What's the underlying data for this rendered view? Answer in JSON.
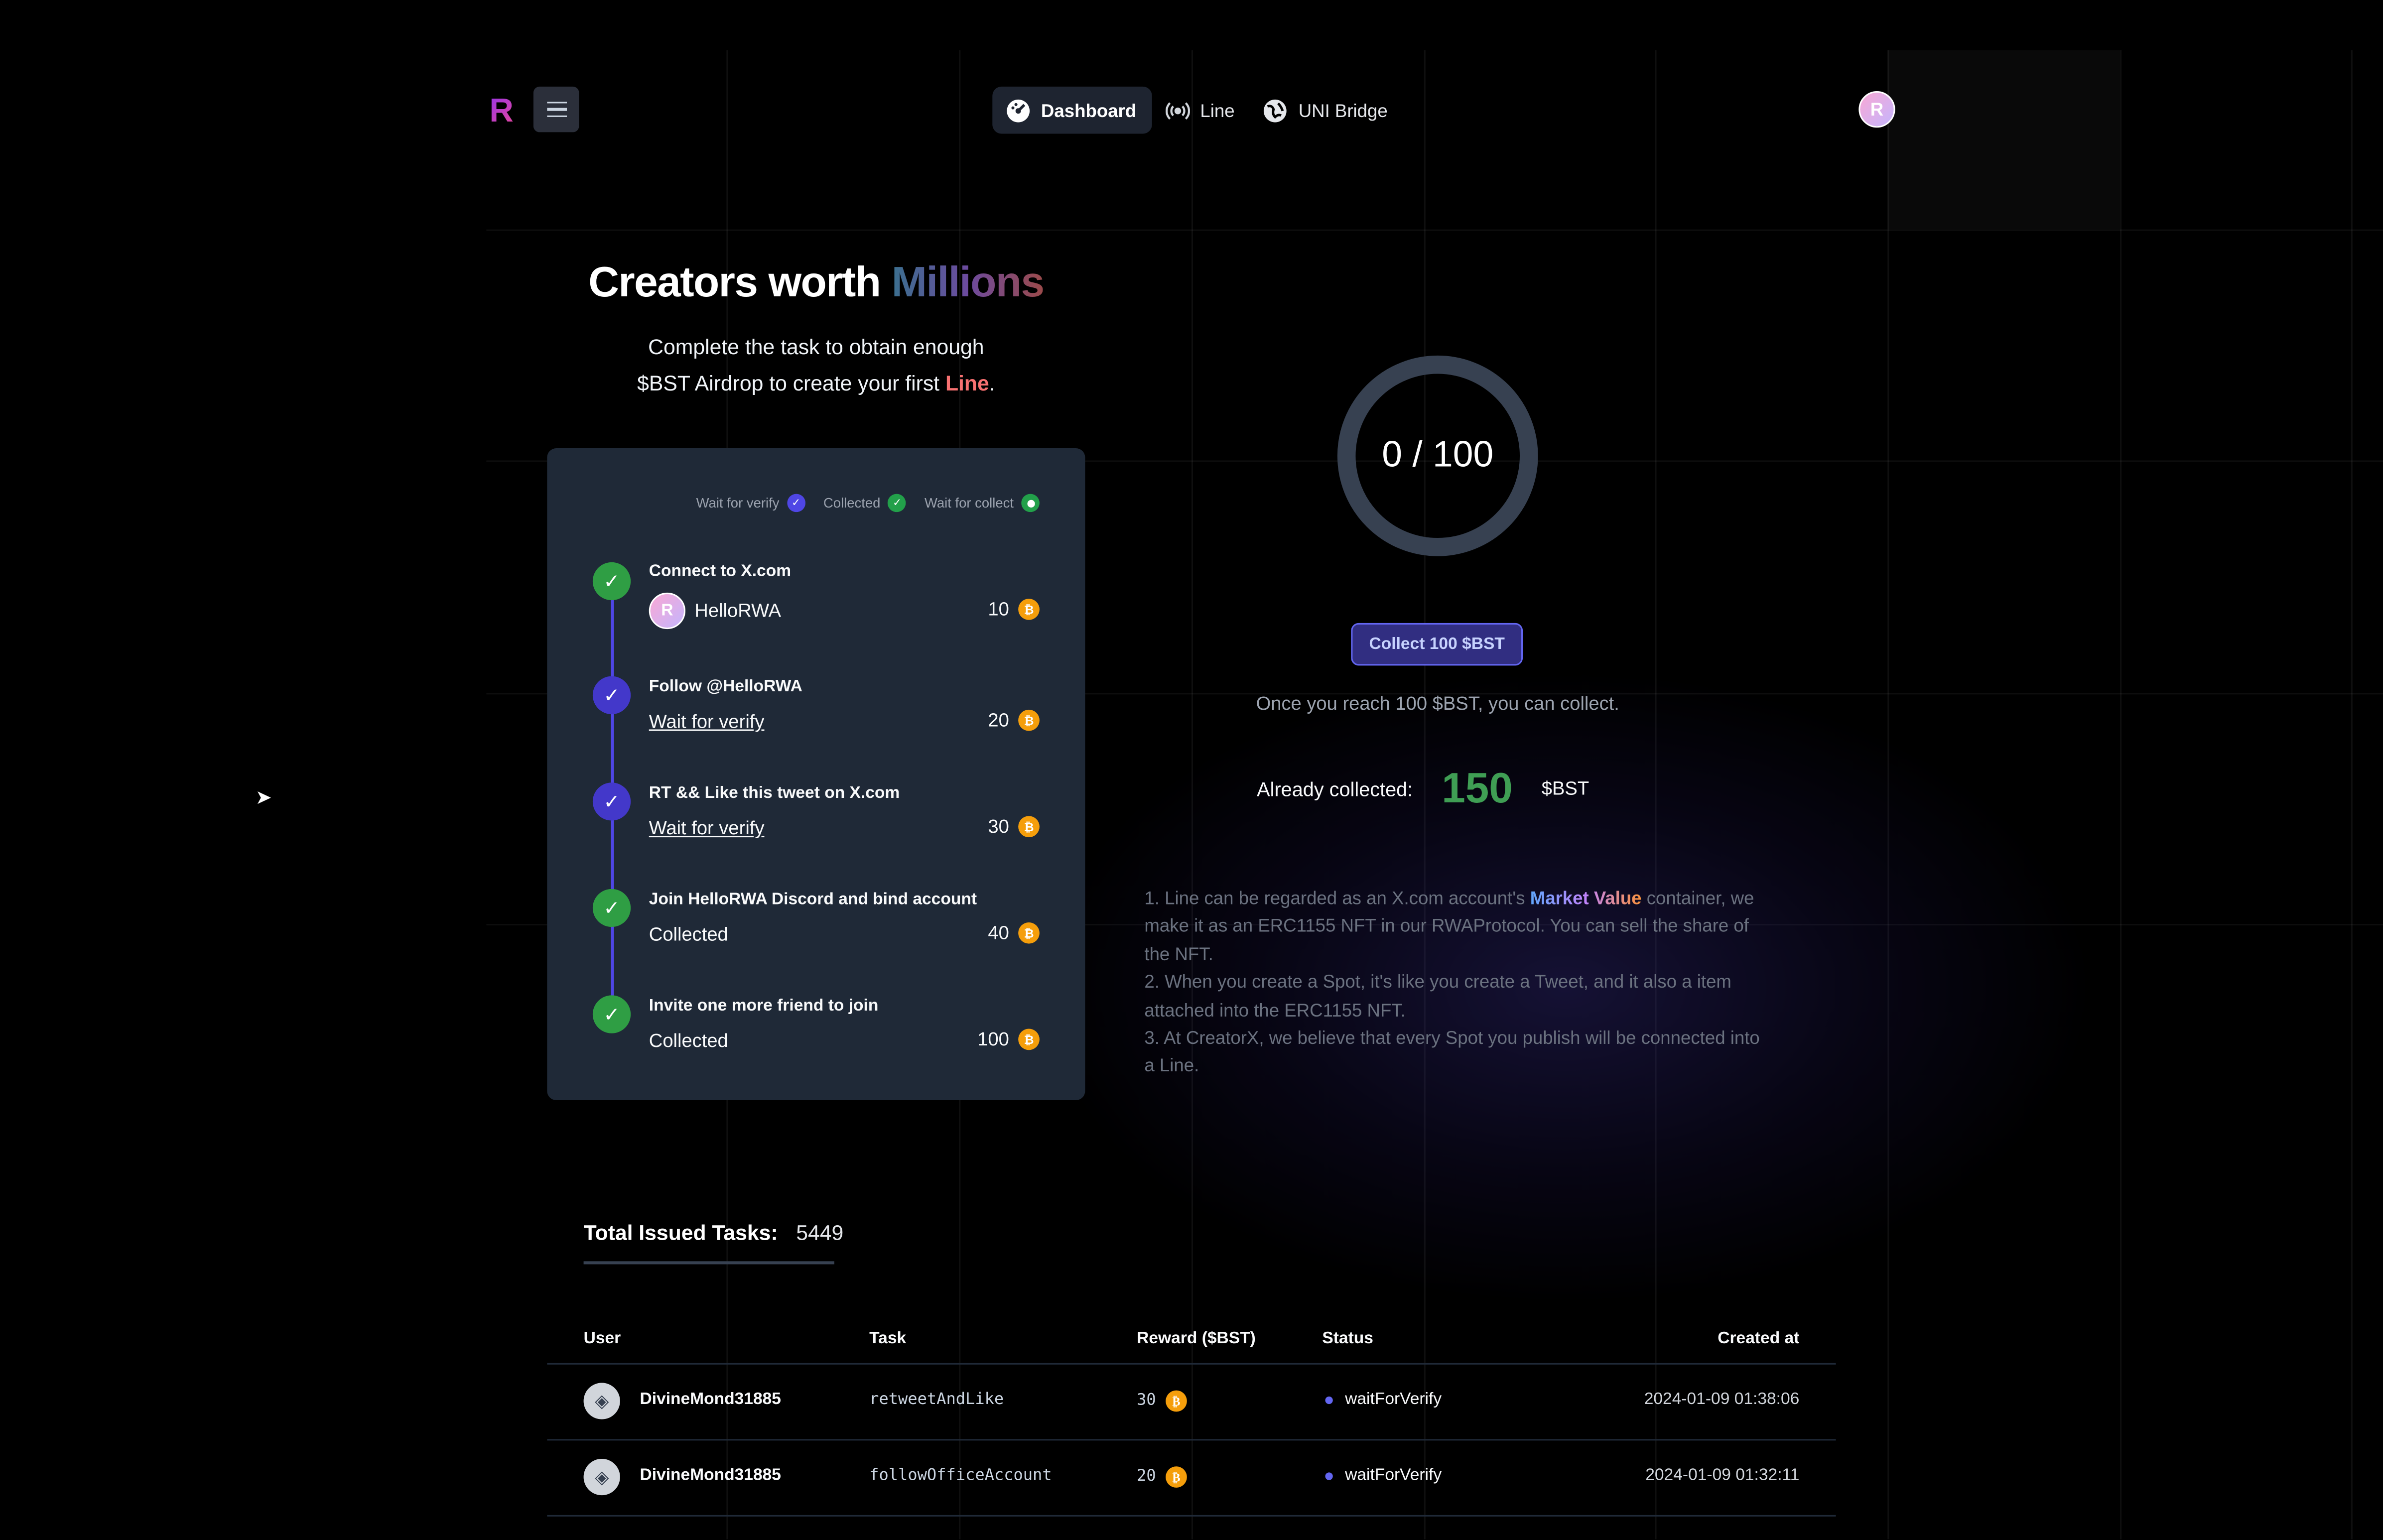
{
  "header": {
    "logo": "R",
    "nav": [
      {
        "label": "Dashboard",
        "icon": "dashboard-icon",
        "active": true
      },
      {
        "label": "Line",
        "icon": "signal-icon",
        "active": false
      },
      {
        "label": "UNI Bridge",
        "icon": "globe-icon",
        "active": false
      }
    ],
    "avatar": "R"
  },
  "hero": {
    "title_prefix": "Creators worth",
    "title_highlight": "Millions",
    "subtitle_line1": "Complete the task to obtain enough",
    "subtitle_line2_prefix": "$BST Airdrop to create your first",
    "subtitle_line2_highlight": "Line",
    "subtitle_line2_suffix": "."
  },
  "legend": {
    "wait_verify": "Wait for verify",
    "collected": "Collected",
    "wait_collect": "Wait for collect"
  },
  "tasks": [
    {
      "title": "Connect to X.com",
      "status": "HelloRWA",
      "amount": "10",
      "state": "collected"
    },
    {
      "title": "Follow @HelloRWA",
      "status": "Wait for verify",
      "amount": "20",
      "state": "verify"
    },
    {
      "title": "RT && Like this tweet on X.com",
      "status": "Wait for verify",
      "amount": "30",
      "state": "verify"
    },
    {
      "title": "Join HelloRWA Discord and bind account",
      "status": "Collected",
      "amount": "40",
      "state": "collected"
    },
    {
      "title": "Invite one more friend to join",
      "status": "Collected",
      "amount": "100",
      "state": "collected"
    }
  ],
  "collector": {
    "current": 0,
    "target": 100,
    "progress_label": "0 / 100",
    "button_label": "Collect 100 $BST",
    "note": "Once you reach 100 $BST, you can collect.",
    "already_label": "Already collected:",
    "already_value": "150",
    "already_unit": "$BST"
  },
  "info": {
    "p1_prefix": "1. Line can be regarded as an X.com account's ",
    "p1_highlight": "Market Value",
    "p1_suffix": " container, we make it as an ERC1155 NFT in our RWAProtocol. You can sell the share of the NFT.",
    "p2": "2. When you create a Spot, it's like you create a Tweet, and it also a item attached into the ERC1155 NFT.",
    "p3": "3. At CreatorX, we believe that every Spot you publish will be connected into a Line."
  },
  "stats": {
    "total_label": "Total Issued Tasks:",
    "total_value": "5449"
  },
  "table": {
    "headers": {
      "user": "User",
      "task": "Task",
      "reward": "Reward ($BST)",
      "status": "Status",
      "created": "Created at"
    },
    "rows": [
      {
        "user": "DivineMond31885",
        "task": "retweetAndLike",
        "reward": "30",
        "status": "waitForVerify",
        "created": "2024-01-09 01:38:06"
      },
      {
        "user": "DivineMond31885",
        "task": "followOfficeAccount",
        "reward": "20",
        "status": "waitForVerify",
        "created": "2024-01-09 01:32:11"
      }
    ]
  },
  "colors": {
    "accent_blue": "#4f46e5",
    "success_green": "#3f9e54",
    "coin": "#f59e0b",
    "highlight_red": "#f87171",
    "card_bg": "#1f2937"
  }
}
